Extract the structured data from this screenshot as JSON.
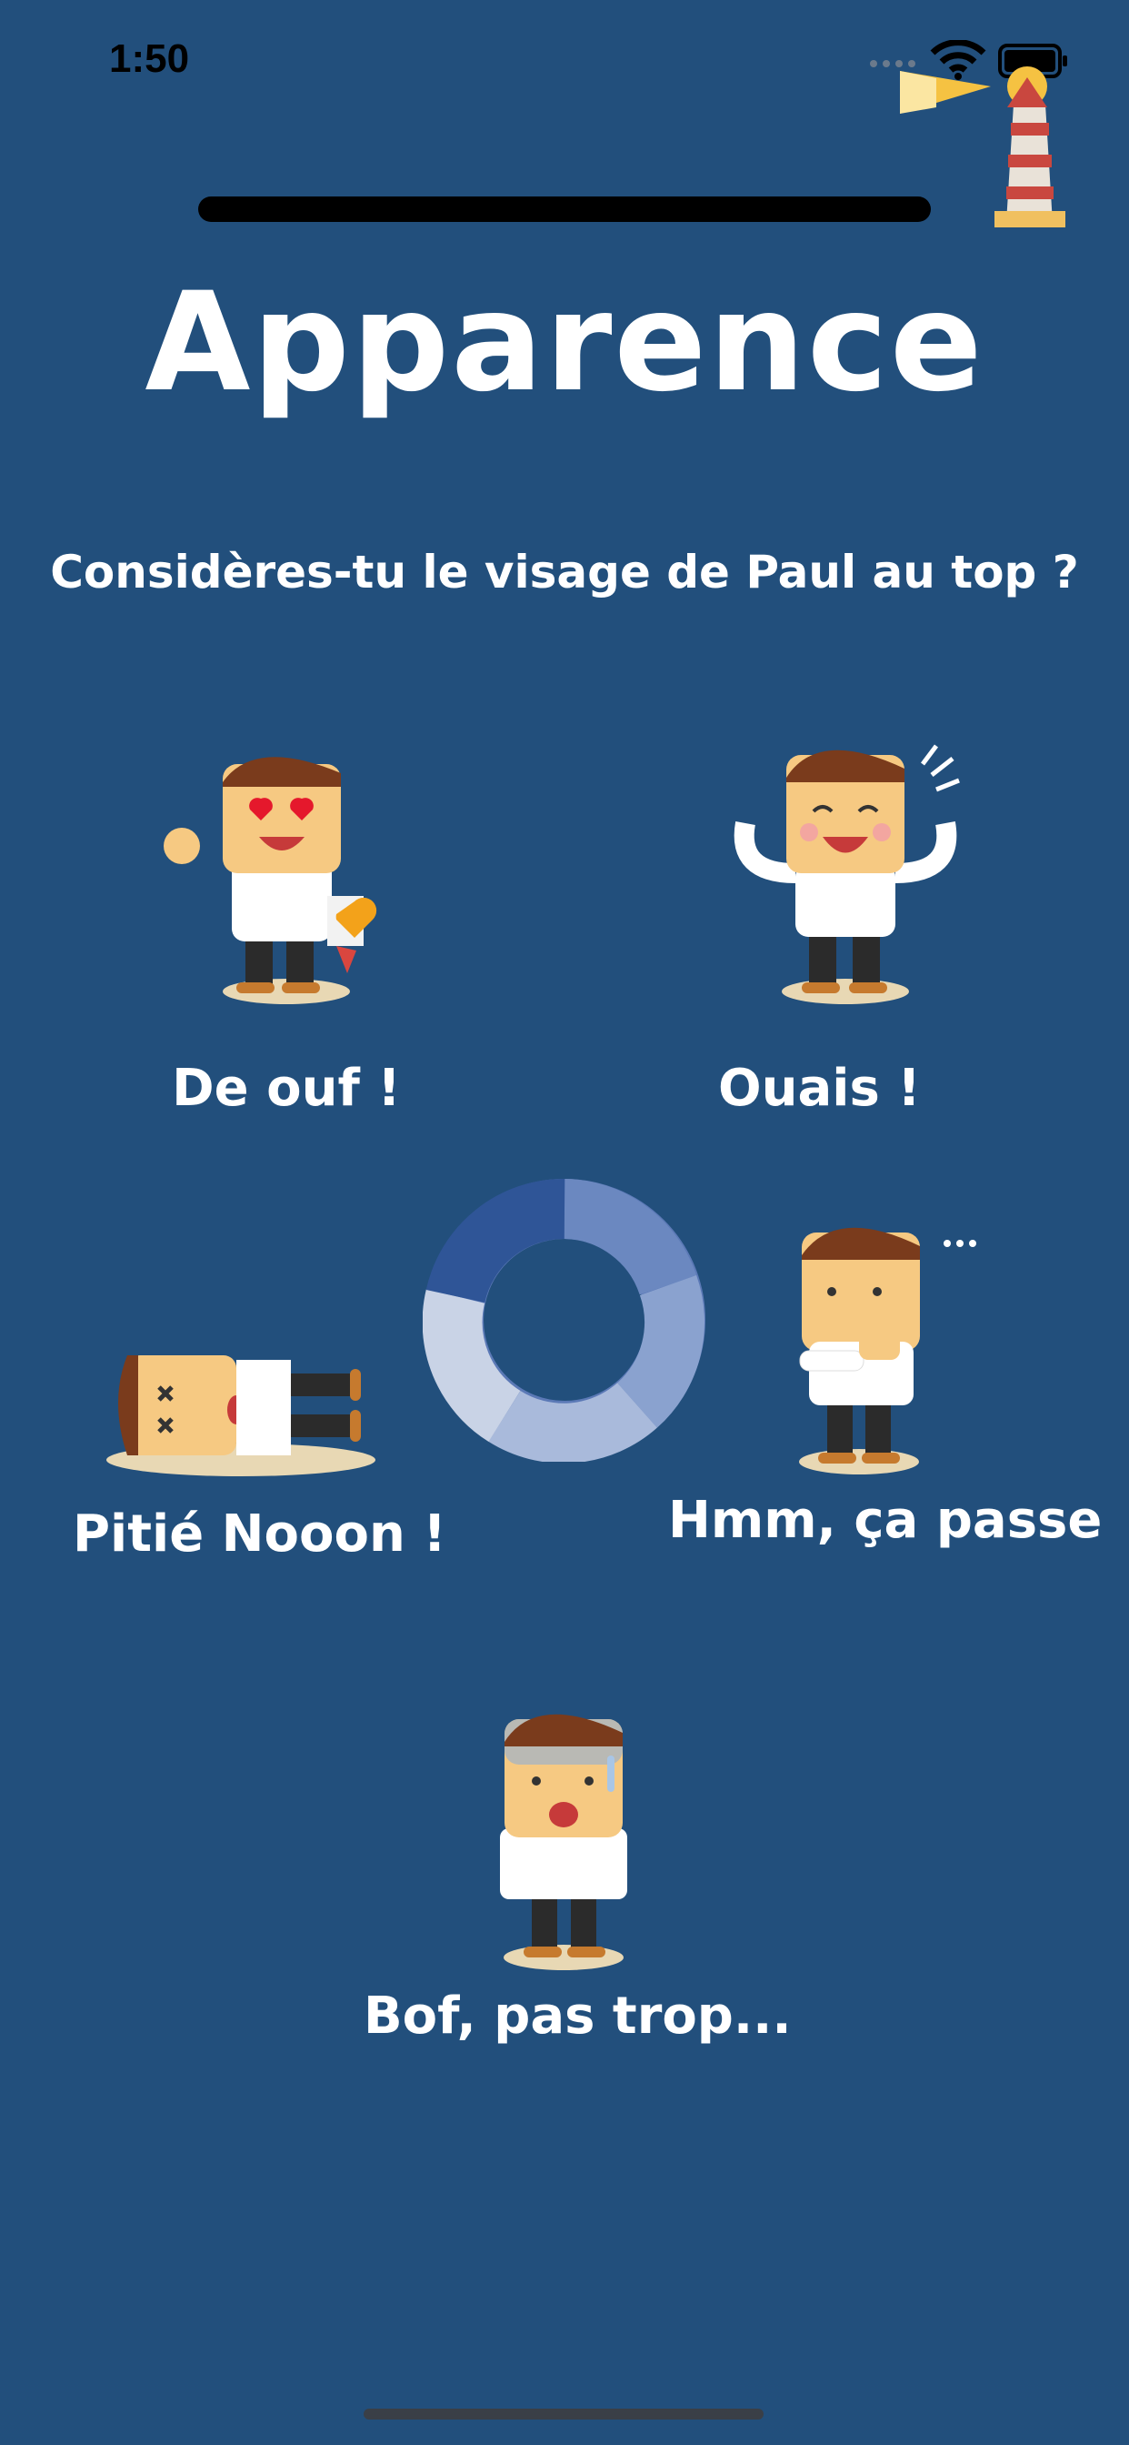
{
  "status_bar": {
    "time": "1:50",
    "icons": [
      "signal-dots-icon",
      "wifi-icon",
      "battery-icon"
    ]
  },
  "brand": {
    "icon": "lighthouse-icon"
  },
  "progress": {
    "value": 1.0
  },
  "title": "Apparence",
  "question": "Considères-tu le visage de Paul au top ?",
  "options": [
    {
      "label": "De ouf !",
      "icon": "character-love-icon"
    },
    {
      "label": "Ouais !",
      "icon": "character-happy-icon"
    },
    {
      "label": "Pitié Nooon !",
      "icon": "character-knocked-out-icon"
    },
    {
      "label": "Hmm, ça passe",
      "icon": "character-thinking-icon"
    },
    {
      "label": "Bof, pas trop...",
      "icon": "character-shocked-icon"
    }
  ],
  "loader": {
    "icon": "loading-ring-icon"
  },
  "colors": {
    "background": "#224f7c",
    "text": "#ffffff",
    "ring_dark": "#2f5597",
    "ring_mid": "#5b79b6",
    "ring_light": "#c9d3e6"
  }
}
